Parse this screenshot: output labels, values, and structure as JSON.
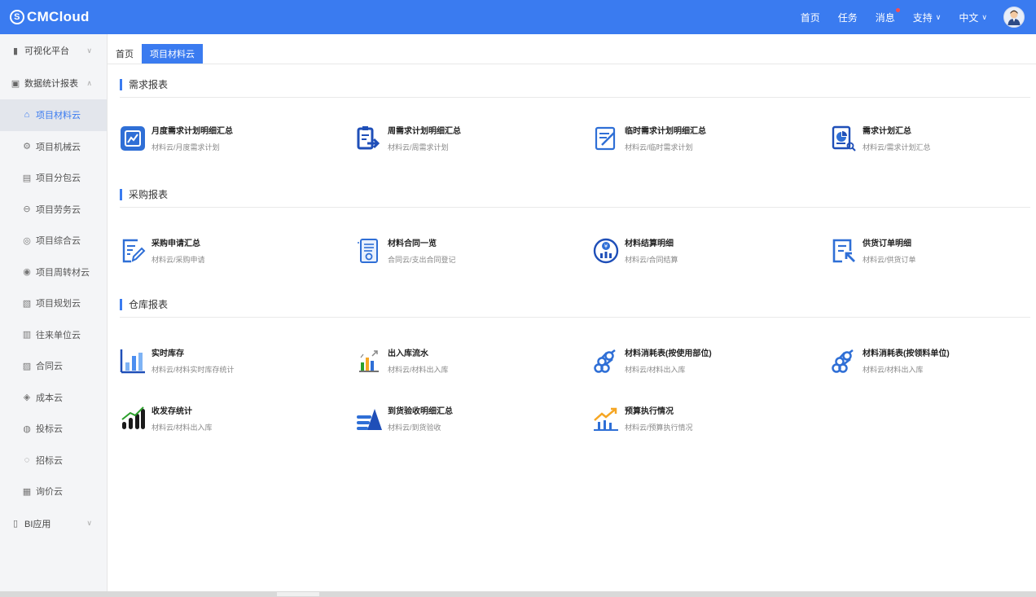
{
  "header": {
    "logo": "CMCloud",
    "nav": [
      {
        "label": "首页",
        "chevron": false,
        "dot": false
      },
      {
        "label": "任务",
        "chevron": false,
        "dot": false
      },
      {
        "label": "消息",
        "chevron": false,
        "dot": true
      },
      {
        "label": "支持",
        "chevron": true,
        "dot": false
      },
      {
        "label": "中文",
        "chevron": true,
        "dot": false
      }
    ]
  },
  "sidebar": {
    "groups": [
      {
        "label": "可视化平台",
        "icon": "bar-icon"
      },
      {
        "label": "数据统计报表",
        "icon": "report-icon"
      },
      {
        "label": "BI应用",
        "icon": "document-icon"
      }
    ],
    "items": [
      {
        "label": "项目材料云",
        "icon": "building-icon",
        "active": true
      },
      {
        "label": "项目机械云",
        "icon": "gear-icon"
      },
      {
        "label": "项目分包云",
        "icon": "clipboard-icon"
      },
      {
        "label": "项目劳务云",
        "icon": "worker-icon"
      },
      {
        "label": "项目综合云",
        "icon": "circle-icon"
      },
      {
        "label": "项目周转材云",
        "icon": "cycle-icon"
      },
      {
        "label": "项目规划云",
        "icon": "plan-icon"
      },
      {
        "label": "往来单位云",
        "icon": "company-icon"
      },
      {
        "label": "合同云",
        "icon": "contract-icon"
      },
      {
        "label": "成本云",
        "icon": "cost-icon"
      },
      {
        "label": "投标云",
        "icon": "bid-icon"
      },
      {
        "label": "招标云",
        "icon": "tender-icon"
      },
      {
        "label": "询价云",
        "icon": "inquiry-icon"
      }
    ]
  },
  "tabs": [
    {
      "label": "首页",
      "active": false
    },
    {
      "label": "项目材料云",
      "active": true
    }
  ],
  "sections": [
    {
      "title": "需求报表",
      "cards": [
        {
          "title": "月度需求计划明细汇总",
          "sub": "材料云/月度需求计划",
          "icon": "chart-board-icon"
        },
        {
          "title": "周需求计划明细汇总",
          "sub": "材料云/周需求计划",
          "icon": "clipboard-arrow-icon"
        },
        {
          "title": "临时需求计划明细汇总",
          "sub": "材料云/临时需求计划",
          "icon": "edit-doc-icon"
        },
        {
          "title": "需求计划汇总",
          "sub": "材料云/需求计划汇总",
          "icon": "pie-search-icon"
        }
      ]
    },
    {
      "title": "采购报表",
      "cards": [
        {
          "title": "采购申请汇总",
          "sub": "材料云/采购申请",
          "icon": "pen-doc-icon"
        },
        {
          "title": "材料合同一览",
          "sub": "合同云/支出合同登记",
          "icon": "contract-doc-icon"
        },
        {
          "title": "材料结算明细",
          "sub": "材料云/合同结算",
          "icon": "yuan-icon"
        },
        {
          "title": "供货订单明细",
          "sub": "材料云/供货订单",
          "icon": "order-icon"
        }
      ]
    },
    {
      "title": "仓库报表",
      "cards": [
        {
          "title": "实时库存",
          "sub": "材料云/材料实时库存统计",
          "icon": "bar-chart-icon"
        },
        {
          "title": "出入库流水",
          "sub": "材料云/材料出入库",
          "icon": "flow-chart-icon"
        },
        {
          "title": "材料消耗表(按使用部位)",
          "sub": "材料云/材料出入库",
          "icon": "pipes-icon"
        },
        {
          "title": "材料消耗表(按领料单位)",
          "sub": "材料云/材料出入库",
          "icon": "pipes-icon"
        },
        {
          "title": "收发存统计",
          "sub": "材料云/材料出入库",
          "icon": "growth-bar-icon"
        },
        {
          "title": "到货验收明细汇总",
          "sub": "材料云/到货验收",
          "icon": "list-triangle-icon"
        },
        {
          "title": "预算执行情况",
          "sub": "材料云/预算执行情况",
          "icon": "trend-icon"
        }
      ]
    }
  ]
}
